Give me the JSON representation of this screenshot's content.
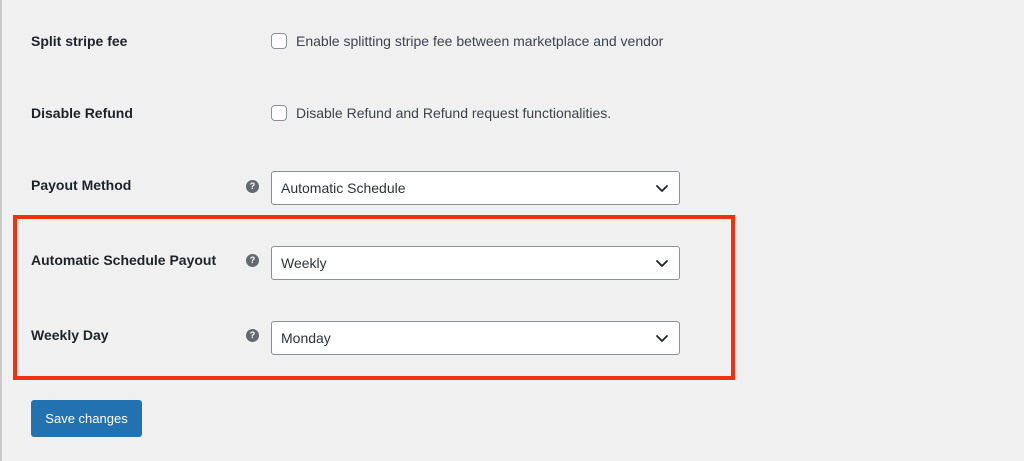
{
  "settings": {
    "split_stripe_fee": {
      "label": "Split stripe fee",
      "checkbox_text": "Enable splitting stripe fee between marketplace and vendor",
      "checked": false
    },
    "disable_refund": {
      "label": "Disable Refund",
      "checkbox_text": "Disable Refund and Refund request functionalities.",
      "checked": false
    },
    "payout_method": {
      "label": "Payout Method",
      "help_icon": "question-mark",
      "value": "Automatic Schedule"
    },
    "automatic_schedule_payout": {
      "label": "Automatic Schedule Payout",
      "help_icon": "question-mark",
      "value": "Weekly"
    },
    "weekly_day": {
      "label": "Weekly Day",
      "help_icon": "question-mark",
      "value": "Monday"
    }
  },
  "help_glyph": "?",
  "save_button": {
    "label": "Save changes"
  },
  "colors": {
    "highlight": "#f0300f",
    "primary_button": "#2271b1",
    "background": "#f0f0f1"
  }
}
